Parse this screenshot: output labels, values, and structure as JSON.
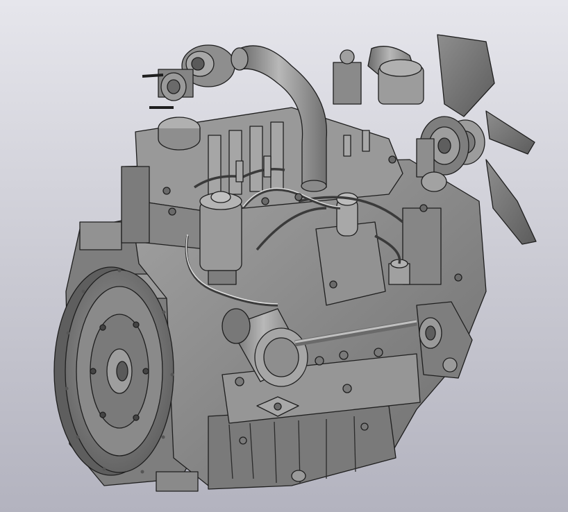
{
  "viewport": {
    "background_top": "#e6e6ec",
    "background_bottom": "#b3b3bf"
  },
  "model": {
    "shade_color": "#8c8c8c",
    "edge_color": "#1e1e1e",
    "light_color": "#b4b4b4",
    "dark_color": "#5a5a5a"
  }
}
